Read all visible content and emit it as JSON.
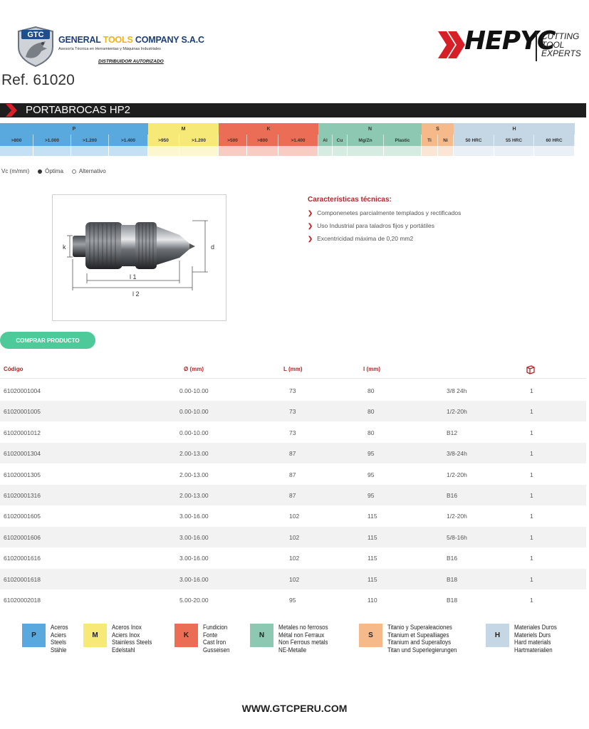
{
  "header": {
    "gtc_badge": "GTC",
    "gtc_name_1": "GENERAL ",
    "gtc_name_2": "TOOLS",
    "gtc_name_3": " COMPANY S.A.C",
    "gtc_sub": "Asesoría Técnica en Herramientas y Máquinas Industriales",
    "gtc_dist": "DISTRIBUIDOR AUTORIZADO",
    "hepyc_word": "HEPYC",
    "hepyc_tag": [
      "CUTTING",
      "TOOL",
      "EXPERTS"
    ]
  },
  "ref": "Ref. 61020",
  "title": "PORTABROCAS HP2",
  "materials": {
    "groups": [
      {
        "label": "P",
        "color": "#5aa9de",
        "subs": [
          ">800",
          ">1.000",
          ">1.200",
          ">1.400"
        ]
      },
      {
        "label": "M",
        "color": "#f7e978",
        "subs": [
          ">950",
          ">1.200"
        ]
      },
      {
        "label": "K",
        "color": "#ec6d55",
        "subs": [
          ">500",
          ">800",
          ">1.400"
        ]
      },
      {
        "label": "N",
        "color": "#8dc9b2",
        "subs": [
          "Al",
          "Cu",
          "Mg/Zn",
          "Plastic"
        ]
      },
      {
        "label": "S",
        "color": "#f5b98a",
        "subs": [
          "Ti",
          "Ni"
        ]
      },
      {
        "label": "H",
        "color": "#c5d7e4",
        "subs": [
          "50 HRC",
          "55 HRC",
          "60 HRC"
        ]
      }
    ]
  },
  "vc": {
    "label": "Vc (m/mm)",
    "optima": "Óptima",
    "alternativo": "Alternativo"
  },
  "drawing": {
    "k": "k",
    "d": "d",
    "l1": "l 1",
    "l2": "l 2"
  },
  "features": {
    "title": "Características técnicas:",
    "bullet": "❯",
    "items": [
      "Componenetes parcialmente templados y rectificados",
      "Uso Industrial para taladros fijos y portátiles",
      "Excentricidad máxima de 0,20 mm2"
    ]
  },
  "buy_label": "COMPRAR PRODUCTO",
  "table": {
    "headers": {
      "code": "Código",
      "d": "Ø (mm)",
      "L": "L (mm)",
      "l": "l (mm)",
      "thread": "",
      "qty_icon": "box-icon"
    },
    "rows": [
      [
        "61020001004",
        "0.00-10.00",
        "73",
        "80",
        "3/8 24h",
        "1"
      ],
      [
        "61020001005",
        "0.00-10.00",
        "73",
        "80",
        "1/2-20h",
        "1"
      ],
      [
        "61020001012",
        "0.00-10.00",
        "73",
        "80",
        "B12",
        "1"
      ],
      [
        "61020001304",
        "2.00-13.00",
        "87",
        "95",
        "3/8-24h",
        "1"
      ],
      [
        "61020001305",
        "2.00-13.00",
        "87",
        "95",
        "1/2-20h",
        "1"
      ],
      [
        "61020001316",
        "2.00-13.00",
        "87",
        "95",
        "B16",
        "1"
      ],
      [
        "61020001605",
        "3.00-16.00",
        "102",
        "115",
        "1/2-20h",
        "1"
      ],
      [
        "61020001606",
        "3.00-16.00",
        "102",
        "115",
        "5/8-16h",
        "1"
      ],
      [
        "61020001616",
        "3.00-16.00",
        "102",
        "115",
        "B16",
        "1"
      ],
      [
        "61020001618",
        "3.00-16.00",
        "102",
        "115",
        "B18",
        "1"
      ],
      [
        "61020002018",
        "5.00-20.00",
        "95",
        "110",
        "B18",
        "1"
      ]
    ]
  },
  "legend": [
    {
      "letter": "P",
      "color": "#5aa9de",
      "lines": [
        "Aceros",
        "Aciers",
        "Steels",
        "Stähle"
      ]
    },
    {
      "letter": "M",
      "color": "#f7e978",
      "lines": [
        "Aceros Inox",
        "Aciers Inox",
        "Stainless Steels",
        "Edelstahl"
      ]
    },
    {
      "letter": "K",
      "color": "#ec6d55",
      "lines": [
        "Fundicion",
        "Fonte",
        "Cast Iron",
        "Gusseisen"
      ]
    },
    {
      "letter": "N",
      "color": "#8dc9b2",
      "lines": [
        "Metales no ferrosos",
        "Métal non Ferraux",
        "Non Ferrous metals",
        "NE-Metalle"
      ]
    },
    {
      "letter": "S",
      "color": "#f5b98a",
      "lines": [
        "Titanio y Superaleaciones",
        "Titanium et Supealliages",
        "Titanium and Superalloys",
        "Titan und Superlegierungen"
      ]
    },
    {
      "letter": "H",
      "color": "#c5d7e4",
      "lines": [
        "Materiales Duros",
        "Materiels Durs",
        "Hard materials",
        "Hartmaterialien"
      ]
    }
  ],
  "footer": "WWW.GTCPERU.COM"
}
